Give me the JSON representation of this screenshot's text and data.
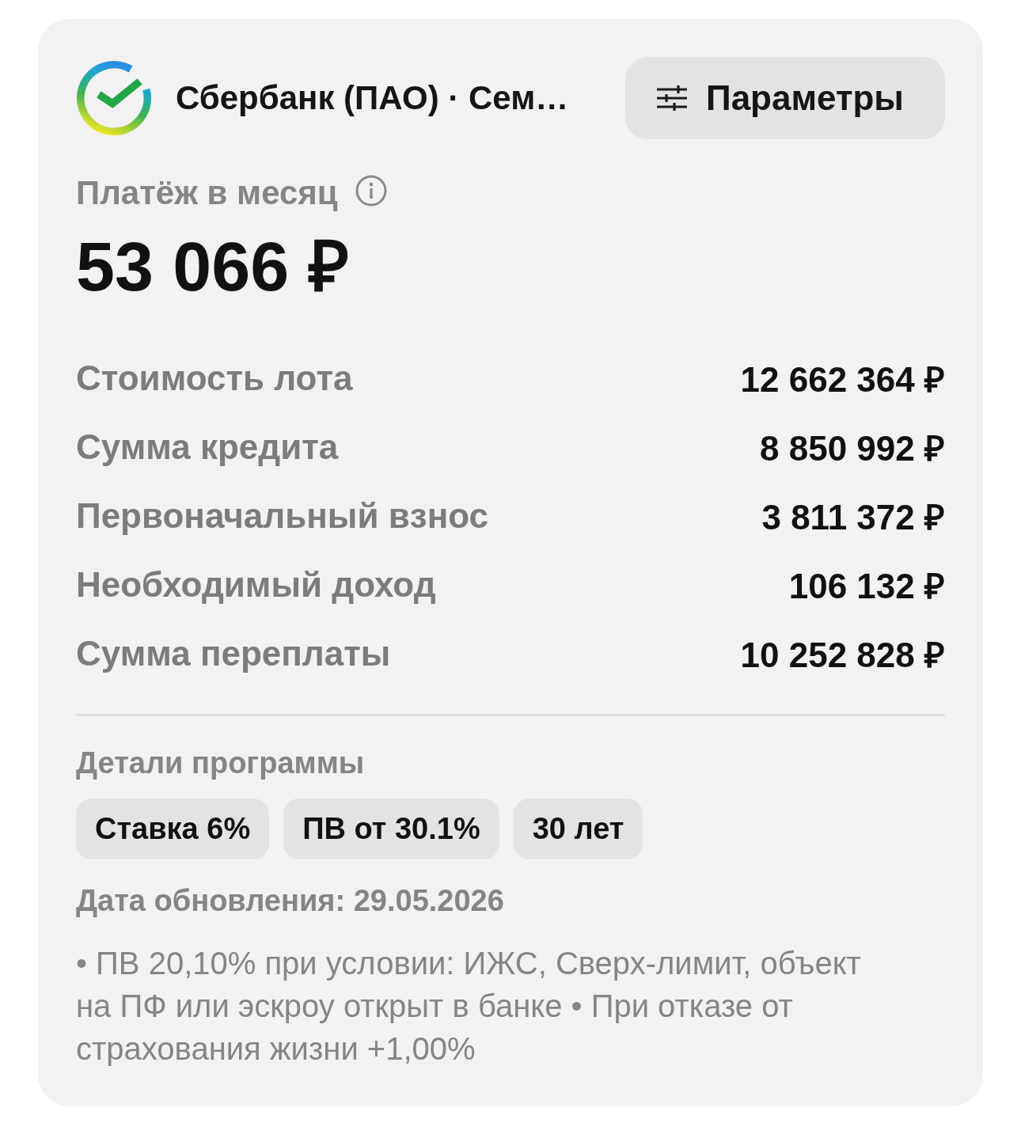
{
  "header": {
    "bank_title": "Сбербанк (ПАО) · Сем…",
    "params_button": {
      "label": "Параметры"
    }
  },
  "payment": {
    "label": "Платёж в месяц",
    "amount": "53 066 ₽"
  },
  "rows": [
    {
      "label": "Стоимость лота",
      "value": "12 662 364 ₽"
    },
    {
      "label": "Сумма кредита",
      "value": "8 850 992 ₽"
    },
    {
      "label": "Первоначальный взнос",
      "value": "3 811 372 ₽"
    },
    {
      "label": "Необходимый доход",
      "value": "106 132 ₽"
    },
    {
      "label": "Сумма переплаты",
      "value": "10 252 828 ₽"
    }
  ],
  "details": {
    "title": "Детали программы",
    "tags": [
      "Ставка 6%",
      "ПВ от 30.1%",
      "30 лет"
    ]
  },
  "updated": "Дата обновления: 29.05.2026",
  "note": "• ПВ 20,10% при условии: ИЖС, Сверх-лимит, объект на ПФ или эскроу открыт в банке • При отказе от страхования жизни +1,00%"
}
